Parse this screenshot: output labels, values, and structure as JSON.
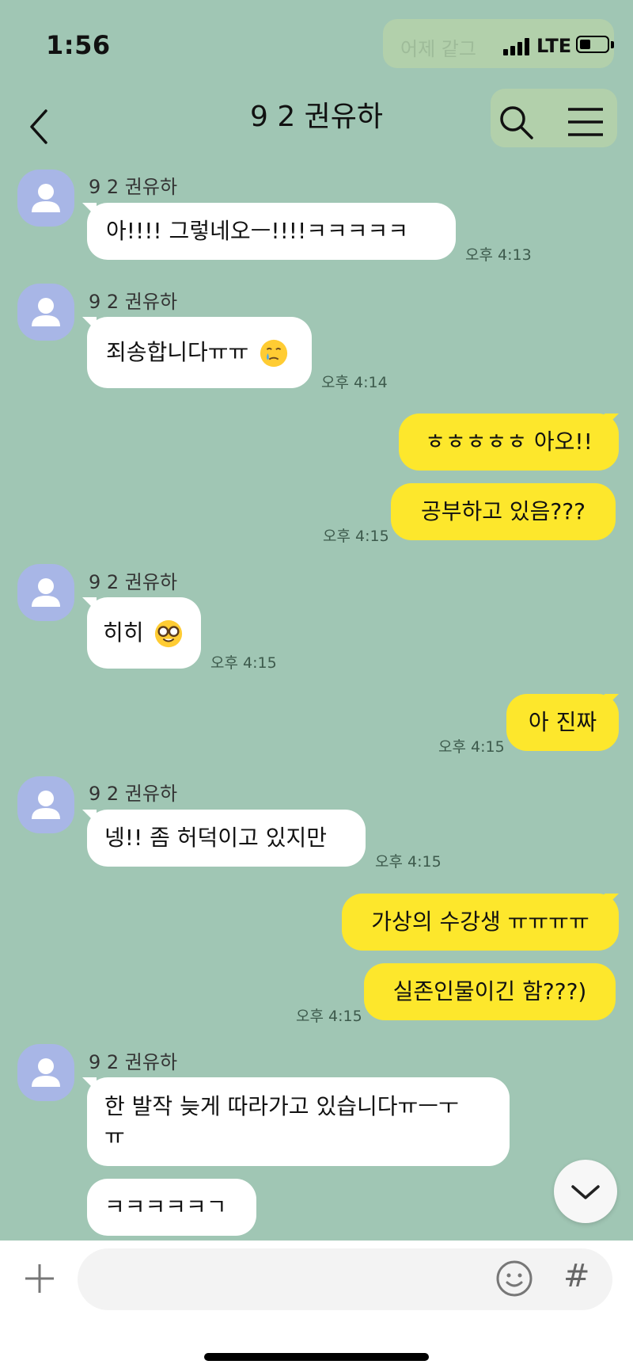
{
  "status_bar": {
    "time": "1:56",
    "network": "LTE",
    "background_ghost_text": "어제 같그"
  },
  "header": {
    "title": "9 2 권유하",
    "icons": [
      "back-arrow-icon",
      "search-icon",
      "hamburger-menu-icon"
    ]
  },
  "messages": [
    {
      "sender": "9 2 권유하",
      "text": "아!!!! 그렇네오ㅡ!!!!ㅋㅋㅋㅋㅋ",
      "time": "오후 4:13"
    },
    {
      "sender": "9 2 권유하",
      "text": "죄송합니다ㅠㅠ",
      "emoji": "crying-face-emoji",
      "time": "오후 4:14"
    },
    {
      "text": "ㅎㅎㅎㅎㅎ 아오!!"
    },
    {
      "text": "공부하고 있음???",
      "time": "오후 4:15"
    },
    {
      "sender": "9 2 권유하",
      "text": "히히",
      "emoji": "nerd-face-emoji",
      "time": "오후 4:15"
    },
    {
      "text": "아 진짜",
      "time": "오후 4:15"
    },
    {
      "sender": "9 2 권유하",
      "text": "넹!! 좀 허덕이고 있지만",
      "time": "오후 4:15"
    },
    {
      "text": "가상의 수강생 ㅠㅠㅠㅠ"
    },
    {
      "text": "실존인물이긴 함???)",
      "time": "오후 4:15"
    },
    {
      "sender": "9 2 권유하",
      "text": "한 발작 늦게 따라가고 있습니다ㅠㅡㅜ\nㅠ"
    },
    {
      "text": "ㅋㅋㅋㅋㅋㄱ"
    }
  ],
  "input": {
    "placeholder": "",
    "icons": [
      "plus-icon",
      "emoji-icon",
      "hashtag-icon",
      "scroll-down-chevron-icon"
    ],
    "hash_label": "#"
  },
  "colors": {
    "background": "#a0c6b4",
    "outgoing_bubble": "#fde72c",
    "incoming_bubble": "#ffffff",
    "avatar": "#a8b6e6"
  }
}
